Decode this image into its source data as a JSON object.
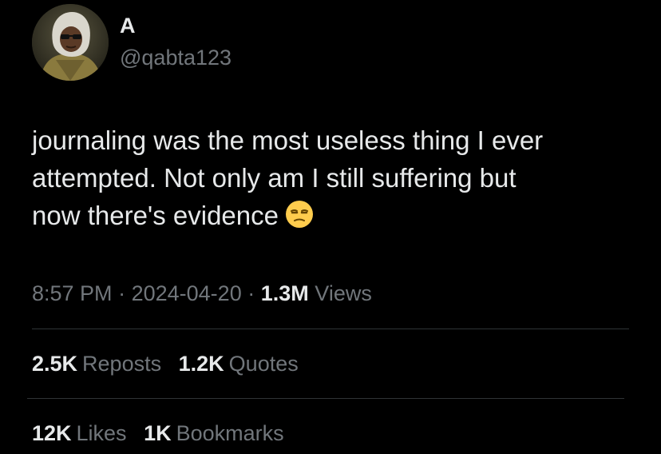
{
  "author": {
    "display_name": "A",
    "handle": "@qabta123",
    "avatar_icon": "profile-photo"
  },
  "tweet": {
    "lines": [
      "journaling was the most useless thing I ever",
      "attempted. Not only am I still suffering but",
      "now there's evidence"
    ],
    "emoji_icon": "unamused-face-emoji"
  },
  "meta": {
    "time": "8:57 PM",
    "separator": "·",
    "date": "2024-04-20",
    "views_count": "1.3M",
    "views_label": "Views"
  },
  "engagement": {
    "reposts": {
      "count": "2.5K",
      "label": "Reposts"
    },
    "quotes": {
      "count": "1.2K",
      "label": "Quotes"
    },
    "likes": {
      "count": "12K",
      "label": "Likes"
    },
    "bookmarks": {
      "count": "1K",
      "label": "Bookmarks"
    }
  },
  "colors": {
    "background": "#000000",
    "primary_text": "#e7e9ea",
    "secondary_text": "#71767b",
    "divider": "#2f3336"
  }
}
